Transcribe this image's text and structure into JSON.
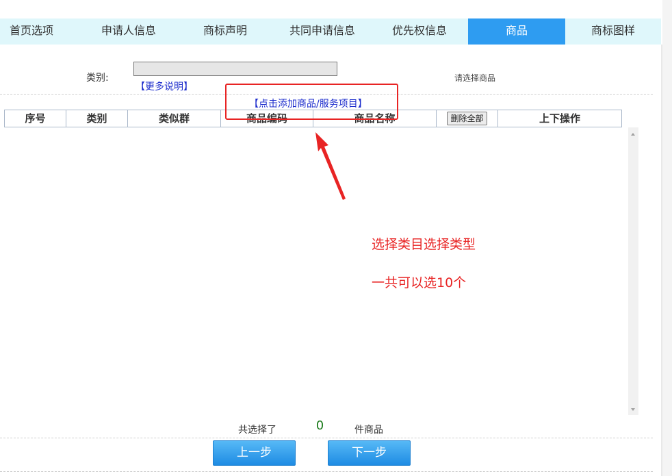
{
  "tabs": [
    {
      "label": "首页选项",
      "active": false
    },
    {
      "label": "申请人信息",
      "active": false
    },
    {
      "label": "商标声明",
      "active": false
    },
    {
      "label": "共同申请信息",
      "active": false
    },
    {
      "label": "优先权信息",
      "active": false
    },
    {
      "label": "商品",
      "active": true
    },
    {
      "label": "商标图样",
      "active": false
    }
  ],
  "category": {
    "label": "类别:",
    "value": "",
    "more_info": "【更多说明】"
  },
  "hint": "请选择商品",
  "add_link": "【点击添加商品/服务项目】",
  "table": {
    "headers": [
      "序号",
      "类别",
      "类似群",
      "商品编码",
      "商品名称",
      "删除全部",
      "上下操作"
    ],
    "rows": []
  },
  "annotation": {
    "line1": "选择类目选择类型",
    "line2": "一共可以选10个"
  },
  "summary": {
    "prefix": "共选择了",
    "count": "0",
    "suffix": "件商品"
  },
  "buttons": {
    "prev": "上一步",
    "next": "下一步"
  },
  "colors": {
    "tab_active": "#2e9cf1",
    "tab_bar": "#dff7fb",
    "link": "#1c2ccc",
    "annotation": "#e82424",
    "count": "#1a7a1a"
  }
}
